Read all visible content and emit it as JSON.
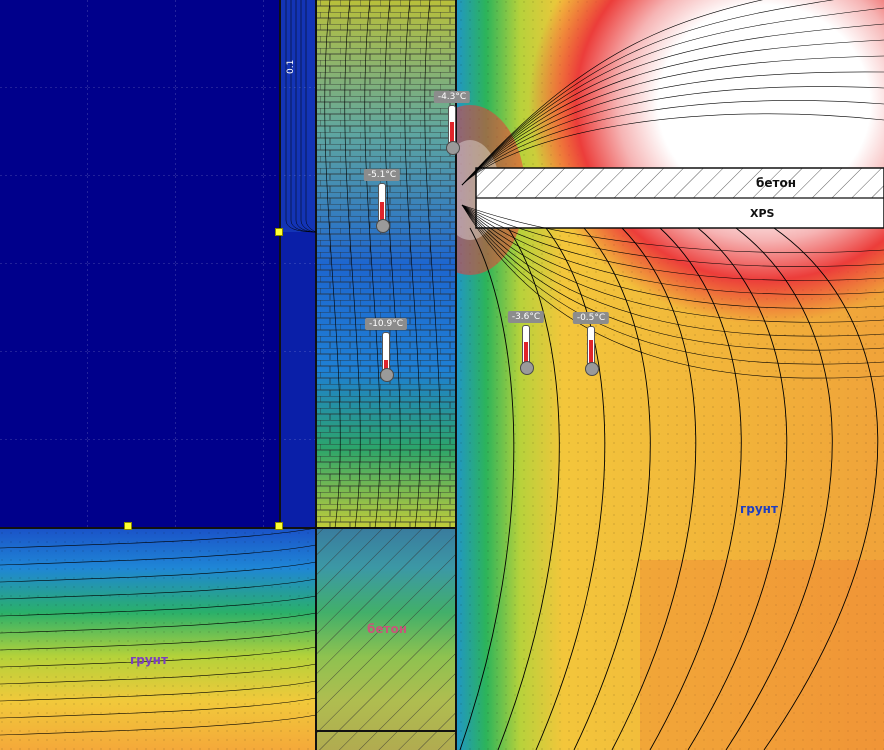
{
  "labels": {
    "beton_top": "бетон",
    "xps": "XPS",
    "ground_right": "грунт",
    "ground_left": "грунт",
    "beton_foot": "бетон",
    "dim_text": "0.1"
  },
  "thermometers": [
    {
      "name": "probe-upper-air",
      "temp": "-4.3°C",
      "level": 0.55
    },
    {
      "name": "probe-wall-upper",
      "temp": "-5.1°C",
      "level": 0.5
    },
    {
      "name": "probe-wall-lower",
      "temp": "-10.9°C",
      "level": 0.25
    },
    {
      "name": "probe-ground-mid",
      "temp": "-3.6°C",
      "level": 0.55
    },
    {
      "name": "probe-ground-right",
      "temp": "-0.5°C",
      "level": 0.65
    }
  ],
  "colors": {
    "outdoor_air": "#00008b",
    "cold": "#1f5fd0",
    "mid": "#2ea84d",
    "warm": "#f6c53a",
    "hot": "#ee4a3a",
    "slab": "#ffffff",
    "thermometer_tag": "#8c8c8c",
    "handle": "#ffff33"
  }
}
